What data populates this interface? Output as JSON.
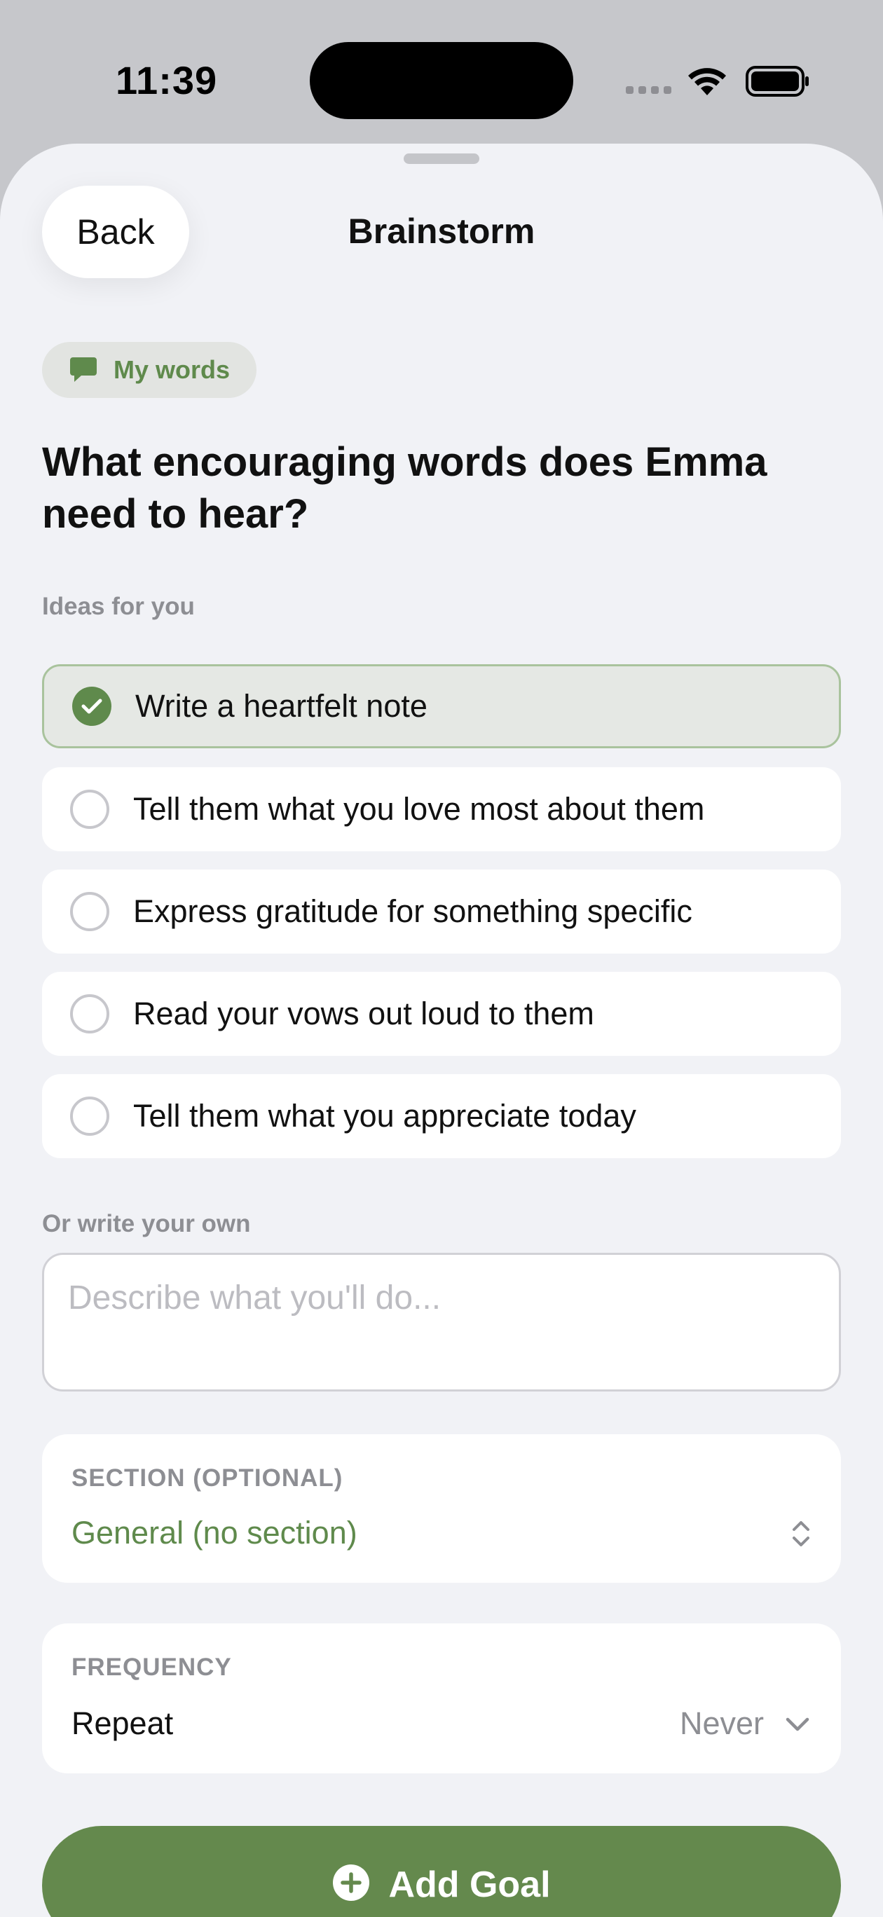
{
  "status_bar": {
    "time": "11:39"
  },
  "nav": {
    "back_label": "Back",
    "title": "Brainstorm"
  },
  "category_tag": {
    "label": "My words",
    "icon": "speech-bubble-icon"
  },
  "question": "What encouraging words does Emma need to hear?",
  "ideas": {
    "label": "Ideas for you",
    "items": [
      {
        "text": "Write a heartfelt note",
        "selected": true
      },
      {
        "text": "Tell them what you love most about them",
        "selected": false
      },
      {
        "text": "Express gratitude for something specific",
        "selected": false
      },
      {
        "text": "Read your vows out loud to them",
        "selected": false
      },
      {
        "text": "Tell them what you appreciate today",
        "selected": false
      }
    ]
  },
  "own": {
    "label": "Or write your own",
    "placeholder": "Describe what you'll do...",
    "value": ""
  },
  "section_picker": {
    "label": "SECTION (OPTIONAL)",
    "value": "General (no section)"
  },
  "frequency": {
    "label": "FREQUENCY",
    "repeat_label": "Repeat",
    "repeat_value": "Never"
  },
  "add_button": {
    "label": "Add Goal"
  },
  "colors": {
    "accent": "#64894d",
    "accent_text": "#5f8a4c",
    "background": "#f1f2f6",
    "secondary_text": "#8d8e93"
  }
}
